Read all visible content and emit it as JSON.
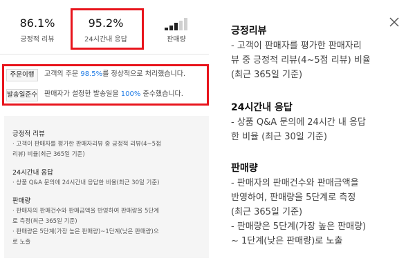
{
  "metrics": [
    {
      "value": "86.1%",
      "label": "긍정적 리뷰"
    },
    {
      "value": "95.2%",
      "label": "24시간내 응답"
    },
    {
      "value": "",
      "label": "판매량",
      "icon": "signal-bars-icon",
      "level": 3,
      "max": 5
    }
  ],
  "order": {
    "tag": "주문이행",
    "pre": "고객의 주문 ",
    "pct": "98.5%",
    "post": "를 정상적으로 처리했습니다."
  },
  "shipping": {
    "tag": "발송일준수",
    "pre": "판매자가 설정한 발송일을 ",
    "pct": "100%",
    "post": " 준수했습니다."
  },
  "left_help": {
    "review_title": "긍정적 리뷰",
    "review_line1": "· 고객이 판매자를 평가한 판매자리뷰 중 긍정적 리뷰(4~5점",
    "review_line2": "리뷰) 비율(최근 365일 기준)",
    "response_title": "24시간내 응답",
    "response_line1": "· 상품 Q&A 문의에 24시간내 응답한 비율(최근 30일 기준)",
    "volume_title": "판매량",
    "volume_line1": "· 판매자의 판매건수와 판매금액을 반영하여 판매량을 5단계",
    "volume_line2": "로 측정(최근 365일 기준)",
    "volume_line3": "· 판매량은 5단계(가장 높은 판매량)~1단계(낮은 판매량)으",
    "volume_line4": "로 노출"
  },
  "right_help": {
    "review_title": "긍정리뷰",
    "review_line1": "- 고객이 판매자를 평가한 판매자리",
    "review_line2": "뷰 중 긍정적 리뷰(4~5점 리뷰) 비율",
    "review_line3": "(최근 365일 기준)",
    "response_title": "24시간내 응답",
    "response_line1": "- 상품 Q&A 문의에 24시간 내 응답",
    "response_line2": "한 비율 (최근 30일 기준)",
    "volume_title": "판매량",
    "volume_line1": "- 판매자의 판매건수와 판매금액을",
    "volume_line2": "반영하여, 판매량을 5단계로 측정",
    "volume_line3": "(최근 365일 기준)",
    "volume_line4": "- 판매량은 5단계(가장 높은 판매량)",
    "volume_line5": "~ 1단계(낮은 판매량)로 노출"
  },
  "colors": {
    "highlight": "#e8141c",
    "accent": "#1e7be6"
  }
}
